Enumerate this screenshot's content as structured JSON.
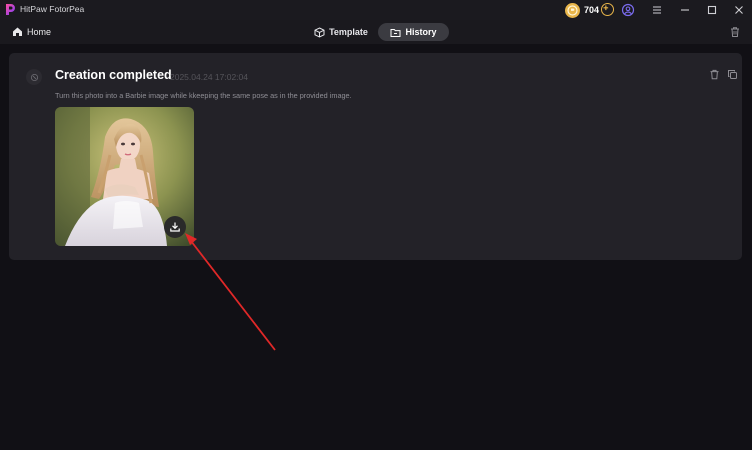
{
  "app": {
    "title": "HitPaw FotorPea"
  },
  "titlebar": {
    "coin_count": "704",
    "colors": {
      "coin": "#e8b54a",
      "user": "#7b6cf0"
    }
  },
  "nav": {
    "home_label": "Home",
    "tabs": [
      {
        "label": "Template",
        "icon": "cube-icon",
        "active": false
      },
      {
        "label": "History",
        "icon": "folder-icon",
        "active": true
      }
    ]
  },
  "history": {
    "items": [
      {
        "status": "Creation completed",
        "timestamp": "2025.04.24 17:02:04",
        "prompt": "Turn this photo into a Barbie image while kkeeping the same pose as in the provided image."
      }
    ]
  },
  "annotation": {
    "arrow_color": "#e02828"
  }
}
